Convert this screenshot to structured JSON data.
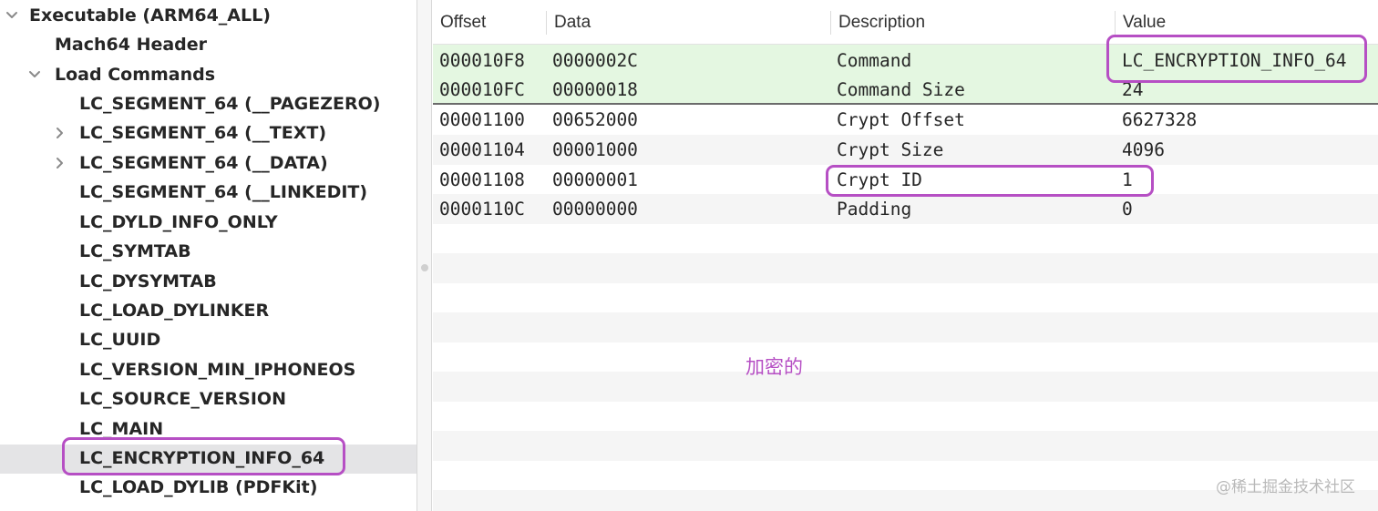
{
  "sidebar": {
    "root": "Executable  (ARM64_ALL)",
    "items": [
      "Mach64 Header",
      "Load Commands",
      "LC_SEGMENT_64 (__PAGEZERO)",
      "LC_SEGMENT_64 (__TEXT)",
      "LC_SEGMENT_64 (__DATA)",
      "LC_SEGMENT_64 (__LINKEDIT)",
      "LC_DYLD_INFO_ONLY",
      "LC_SYMTAB",
      "LC_DYSYMTAB",
      "LC_LOAD_DYLINKER",
      "LC_UUID",
      "LC_VERSION_MIN_IPHONEOS",
      "LC_SOURCE_VERSION",
      "LC_MAIN",
      "LC_ENCRYPTION_INFO_64",
      "LC_LOAD_DYLIB (PDFKit)"
    ],
    "selected": "LC_ENCRYPTION_INFO_64"
  },
  "table": {
    "columns": [
      "Offset",
      "Data",
      "Description",
      "Value"
    ],
    "rows": [
      {
        "offset": "000010F8",
        "data": "0000002C",
        "description": "Command",
        "value": "LC_ENCRYPTION_INFO_64"
      },
      {
        "offset": "000010FC",
        "data": "00000018",
        "description": "Command Size",
        "value": "24"
      },
      {
        "offset": "00001100",
        "data": "00652000",
        "description": "Crypt Offset",
        "value": "6627328"
      },
      {
        "offset": "00001104",
        "data": "00001000",
        "description": "Crypt Size",
        "value": "4096"
      },
      {
        "offset": "00001108",
        "data": "00000001",
        "description": "Crypt ID",
        "value": "1"
      },
      {
        "offset": "0000110C",
        "data": "00000000",
        "description": "Padding",
        "value": "0"
      }
    ]
  },
  "annotation": {
    "note": "加密的"
  },
  "watermark": "@稀土掘金技术社区",
  "colors": {
    "annotation": "#b64fc4",
    "row_highlight": "#e4f7e1",
    "selection": "#e4e4e6"
  },
  "icons": {
    "expand_down": "chevron-down-icon",
    "collapsed": "chevron-right-icon"
  }
}
